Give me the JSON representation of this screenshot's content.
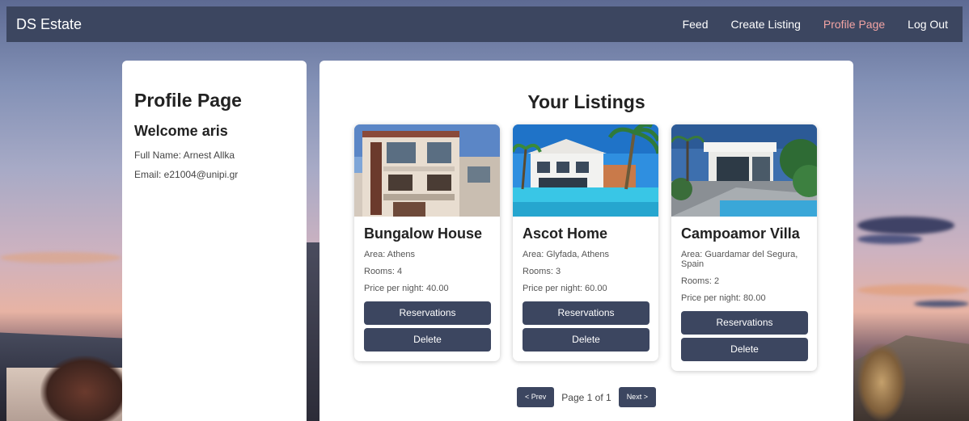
{
  "navbar": {
    "brand": "DS Estate",
    "links": [
      {
        "label": "Feed",
        "active": false
      },
      {
        "label": "Create Listing",
        "active": false
      },
      {
        "label": "Profile Page",
        "active": true
      },
      {
        "label": "Log Out",
        "active": false
      }
    ]
  },
  "profile": {
    "title": "Profile Page",
    "welcome": "Welcome aris",
    "full_name": "Full Name: Arnest Allka",
    "email": "Email: e21004@unipi.gr"
  },
  "listings": {
    "title": "Your Listings",
    "items": [
      {
        "name": "Bungalow House",
        "area": "Area: Athens",
        "rooms": "Rooms: 4",
        "price": "Price per night: 40.00",
        "reservations_label": "Reservations",
        "delete_label": "Delete"
      },
      {
        "name": "Ascot Home",
        "area": "Area: Glyfada, Athens",
        "rooms": "Rooms: 3",
        "price": "Price per night: 60.00",
        "reservations_label": "Reservations",
        "delete_label": "Delete"
      },
      {
        "name": "Campoamor Villa",
        "area": "Area: Guardamar del Segura, Spain",
        "rooms": "Rooms: 2",
        "price": "Price per night: 80.00",
        "reservations_label": "Reservations",
        "delete_label": "Delete"
      }
    ]
  },
  "pagination": {
    "prev_label": "< Prev",
    "page_info": "Page 1 of 1",
    "next_label": "Next >"
  },
  "colors": {
    "nav_bg": "#3c4660",
    "active_link": "#f2a4a4",
    "button_bg": "#3c4660"
  }
}
